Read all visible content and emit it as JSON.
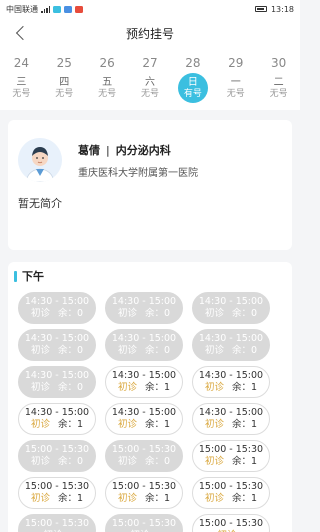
{
  "status_bar": {
    "carrier": "中国联通",
    "time": "13:18",
    "battery_icon": "battery-icon",
    "signal_icon": "signal-icon"
  },
  "header": {
    "title": "预约挂号",
    "back_icon": "back-chevron-icon"
  },
  "dates": [
    {
      "day": "24",
      "weekday": "三",
      "status": "无号",
      "active": false
    },
    {
      "day": "25",
      "weekday": "四",
      "status": "无号",
      "active": false
    },
    {
      "day": "26",
      "weekday": "五",
      "status": "无号",
      "active": false
    },
    {
      "day": "27",
      "weekday": "六",
      "status": "无号",
      "active": false
    },
    {
      "day": "28",
      "weekday": "日",
      "status": "有号",
      "active": true
    },
    {
      "day": "29",
      "weekday": "一",
      "status": "无号",
      "active": false
    },
    {
      "day": "30",
      "weekday": "二",
      "status": "无号",
      "active": false
    }
  ],
  "doctor": {
    "name": "葛倩",
    "separator": "|",
    "department": "内分泌内科",
    "hospital": "重庆医科大学附属第一医院",
    "intro": "暂无简介"
  },
  "schedule": {
    "period_label": "下午",
    "slots": [
      {
        "time": "14:30 - 15:00",
        "type": "初诊",
        "remaining": "余：0",
        "state": "full"
      },
      {
        "time": "14:30 - 15:00",
        "type": "初诊",
        "remaining": "余：0",
        "state": "full"
      },
      {
        "time": "14:30 - 15:00",
        "type": "初诊",
        "remaining": "余：0",
        "state": "full"
      },
      {
        "time": "14:30 - 15:00",
        "type": "初诊",
        "remaining": "余：0",
        "state": "full"
      },
      {
        "time": "14:30 - 15:00",
        "type": "初诊",
        "remaining": "余：0",
        "state": "full"
      },
      {
        "time": "14:30 - 15:00",
        "type": "初诊",
        "remaining": "余：0",
        "state": "full"
      },
      {
        "time": "14:30 - 15:00",
        "type": "初诊",
        "remaining": "余：0",
        "state": "full"
      },
      {
        "time": "14:30 - 15:00",
        "type": "初诊",
        "remaining": "余：1",
        "state": "open"
      },
      {
        "time": "14:30 - 15:00",
        "type": "初诊",
        "remaining": "余：1",
        "state": "open"
      },
      {
        "time": "14:30 - 15:00",
        "type": "初诊",
        "remaining": "余：1",
        "state": "open"
      },
      {
        "time": "14:30 - 15:00",
        "type": "初诊",
        "remaining": "余：1",
        "state": "open"
      },
      {
        "time": "14:30 - 15:00",
        "type": "初诊",
        "remaining": "余：1",
        "state": "open"
      },
      {
        "time": "15:00 - 15:30",
        "type": "初诊",
        "remaining": "余：0",
        "state": "full"
      },
      {
        "time": "15:00 - 15:30",
        "type": "初诊",
        "remaining": "余：0",
        "state": "full"
      },
      {
        "time": "15:00 - 15:30",
        "type": "初诊",
        "remaining": "余：1",
        "state": "open"
      },
      {
        "time": "15:00 - 15:30",
        "type": "初诊",
        "remaining": "余：1",
        "state": "open"
      },
      {
        "time": "15:00 - 15:30",
        "type": "初诊",
        "remaining": "余：1",
        "state": "open"
      },
      {
        "time": "15:00 - 15:30",
        "type": "初诊",
        "remaining": "余：1",
        "state": "open"
      },
      {
        "time": "15:00 - 15:30",
        "type": "初诊",
        "remaining": "",
        "state": "full"
      },
      {
        "time": "15:00 - 15:30",
        "type": "初诊",
        "remaining": "",
        "state": "full"
      },
      {
        "time": "15:00 - 15:30",
        "type": "初诊",
        "remaining": "",
        "state": "open"
      }
    ]
  },
  "colors": {
    "accent": "#3bbfe0",
    "slot_full": "#d9d9d9",
    "type_label": "#d9a63a"
  }
}
